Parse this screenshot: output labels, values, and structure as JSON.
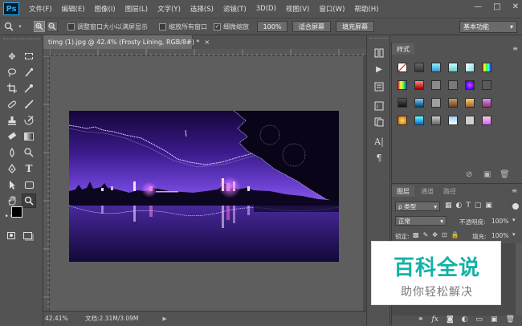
{
  "app": {
    "logo": "Ps"
  },
  "menu": [
    "文件(F)",
    "编辑(E)",
    "图像(I)",
    "图层(L)",
    "文字(Y)",
    "选择(S)",
    "滤镜(T)",
    "3D(D)",
    "视图(V)",
    "窗口(W)",
    "帮助(H)"
  ],
  "window_controls": {
    "minimize": "—",
    "maximize": "□",
    "close": "✕"
  },
  "options": {
    "resize_windows": "调整窗口大小以满屏显示",
    "zoom_all": "缩放所有窗口",
    "scrubby_zoom": "细微缩放",
    "zoom_value": "100%",
    "fit_screen": "适合屏幕",
    "fill_screen": "填充屏幕",
    "workspace": "基本功能"
  },
  "document": {
    "tab_title": "timg (1).jpg @ 42.4% (Frosty Lining, RGB/8#) *",
    "close": "×"
  },
  "status": {
    "zoom": "42.41%",
    "doc_size": "文档:2.31M/3.09M",
    "arrow": "▶"
  },
  "styles_panel": {
    "title": "样式"
  },
  "layers_panel": {
    "tabs": [
      "图层",
      "通道",
      "路径"
    ],
    "kind_filter": "ρ 类型",
    "blend_mode": "正常",
    "opacity_label": "不透明度:",
    "opacity_value": "100%",
    "lock_label": "锁定:",
    "fill_label": "填充:",
    "fill_value": "100%"
  },
  "watermark": {
    "title": "百科全说",
    "subtitle": "助你轻松解决"
  },
  "colors": {
    "accent": "#31a8ff",
    "watermark_text": "#12b2a6",
    "panel_bg": "#535353"
  }
}
